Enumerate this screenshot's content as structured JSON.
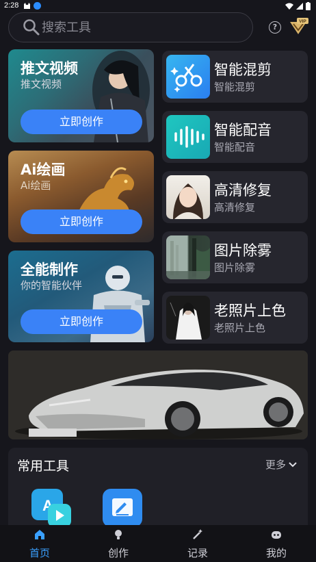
{
  "status_bar": {
    "time": "2:28"
  },
  "search": {
    "placeholder": "搜索工具"
  },
  "feature_cards": [
    {
      "title": "推文视频",
      "subtitle": "推文视频",
      "button": "立即创作"
    },
    {
      "title": "Ai绘画",
      "subtitle": "Ai绘画",
      "button": "立即创作"
    },
    {
      "title": "全能制作",
      "subtitle": "你的智能伙伴",
      "button": "立即创作"
    }
  ],
  "tool_cards": [
    {
      "title": "智能混剪",
      "subtitle": "智能混剪",
      "icon": "scissors-icon"
    },
    {
      "title": "智能配音",
      "subtitle": "智能配音",
      "icon": "audio-wave-icon"
    },
    {
      "title": "高清修复",
      "subtitle": "高清修复",
      "icon": "portrait-thumbnail"
    },
    {
      "title": "图片除雾",
      "subtitle": "图片除雾",
      "icon": "landscape-thumbnail"
    },
    {
      "title": "老照片上色",
      "subtitle": "老照片上色",
      "icon": "old-photo-thumbnail"
    }
  ],
  "common_tools": {
    "title": "常用工具",
    "more": "更多"
  },
  "nav": [
    {
      "label": "首页",
      "icon": "home-icon",
      "active": true
    },
    {
      "label": "创作",
      "icon": "lightbulb-icon",
      "active": false
    },
    {
      "label": "记录",
      "icon": "magic-wand-icon",
      "active": false
    },
    {
      "label": "我的",
      "icon": "profile-icon",
      "active": false
    }
  ],
  "colors": {
    "accent": "#3a82f7",
    "nav_active": "#3aa0ff",
    "background": "#16161c",
    "card": "#26262e"
  }
}
